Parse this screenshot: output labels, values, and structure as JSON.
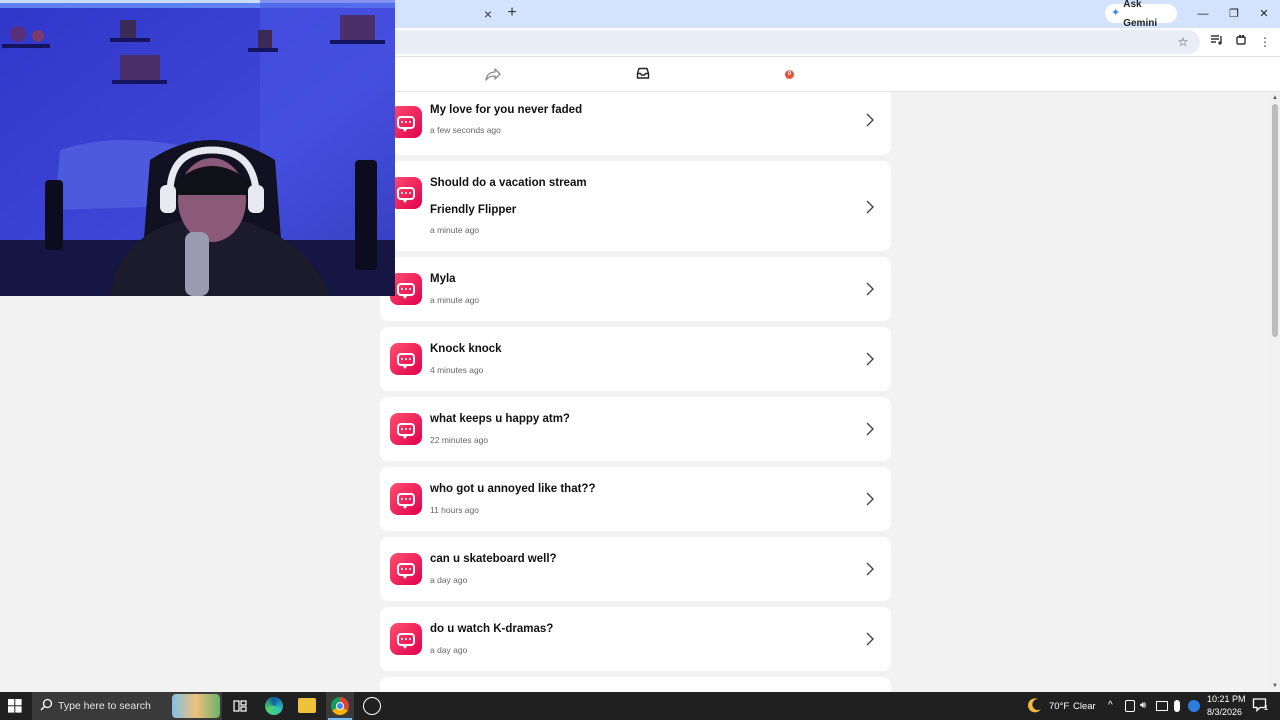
{
  "browser": {
    "new_tab_symbol": "+",
    "close_tab_symbol": "×",
    "ask_gemini_label": "Ask Gemini",
    "window_controls": {
      "minimize": "—",
      "restore": "❐",
      "close": "✕"
    }
  },
  "app": {
    "nav_badge": "0",
    "accent_color": "#e8114f",
    "messages": [
      {
        "title": "My love for you never faded",
        "subtitle": "",
        "time": "a few seconds ago"
      },
      {
        "title": "Should do a vacation stream",
        "subtitle": "Friendly Flipper",
        "time": "a minute ago"
      },
      {
        "title": "Myla",
        "subtitle": "",
        "time": "a minute ago"
      },
      {
        "title": "Knock knock",
        "subtitle": "",
        "time": "4 minutes ago"
      },
      {
        "title": "what keeps u happy atm?",
        "subtitle": "",
        "time": "22 minutes ago"
      },
      {
        "title": "who got u annoyed like that??",
        "subtitle": "",
        "time": "11 hours ago"
      },
      {
        "title": "can u skateboard well?",
        "subtitle": "",
        "time": "a day ago"
      },
      {
        "title": "do u watch K-dramas?",
        "subtitle": "",
        "time": "a day ago"
      }
    ]
  },
  "taskbar": {
    "search_placeholder": "Type here to search",
    "weather_temp": "70°F",
    "weather_text": "Clear",
    "clock_time": "10:21 PM",
    "clock_date": "8/3/2026",
    "notification_count": "1"
  }
}
